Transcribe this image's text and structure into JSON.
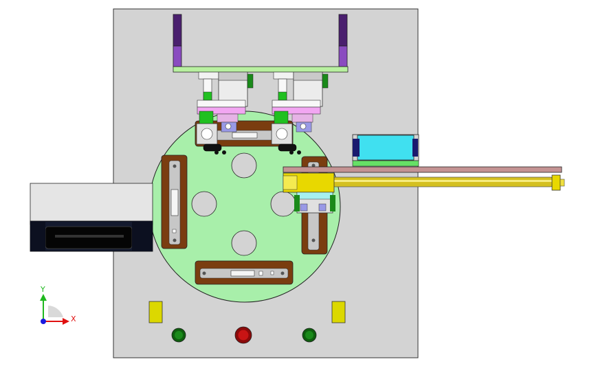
{
  "view": {
    "background": "#ffffff",
    "colors": {
      "base_plate": "#d3d3d3",
      "turntable": "#a8efaa",
      "fixture_brown": "#7a3d10",
      "fixture_insert": "#c7c7c7",
      "bracket_purple": "#6a2f93",
      "crossbar_green": "#b8f0a0",
      "cylinder_yellow": "#e8d800",
      "rail_rose": "#c49393",
      "cyan_block": "#40e0f0",
      "motor_box": "#e5e5e5",
      "motor_dark": "#141a2e",
      "button_green": "#1a8a1a",
      "button_red": "#c81414",
      "indicator_yellow": "#dcd800",
      "pink_plate": "#f2a6f2",
      "lavender_block": "#9999e6"
    }
  },
  "triad": {
    "y_label": "Y",
    "x_label": "X",
    "y_color": "#1fb81f",
    "x_color": "#e01010",
    "z_color": "#1a1ae0"
  }
}
